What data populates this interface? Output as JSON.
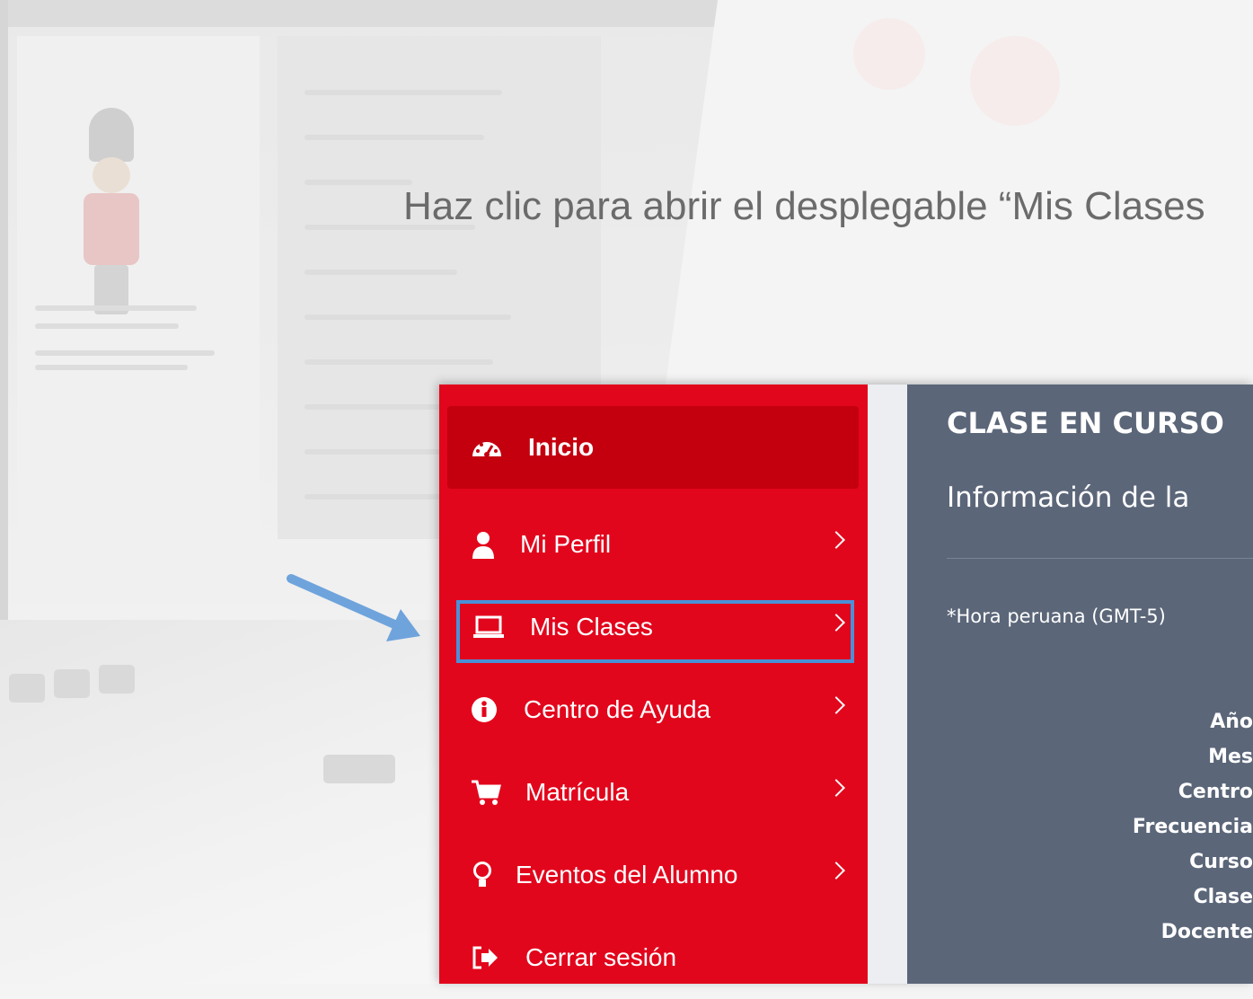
{
  "instruction": "Haz clic para abrir el desplegable “Mis Clases",
  "sidebar": {
    "items": [
      {
        "label": "Inicio",
        "icon": "dashboard-icon",
        "active": true
      },
      {
        "label": "Mi Perfil",
        "icon": "user-icon"
      },
      {
        "label": "Mis Clases",
        "icon": "laptop-icon",
        "highlighted": true
      },
      {
        "label": "Centro de Ayuda",
        "icon": "info-icon"
      },
      {
        "label": "Matrícula",
        "icon": "cart-icon"
      },
      {
        "label": "Eventos del Alumno",
        "icon": "lightbulb-icon"
      },
      {
        "label": "Cerrar sesión",
        "icon": "signout-icon"
      }
    ]
  },
  "content": {
    "title": "CLASE EN CURSO",
    "subtitle": "Información de la",
    "timezone_note": "*Hora peruana (GMT-5)",
    "fields": [
      "Año",
      "Mes",
      "Centro",
      "Frecuencia",
      "Curso",
      "Clase",
      "Docente"
    ]
  },
  "colors": {
    "sidebar_bg": "#e2061c",
    "sidebar_active": "#c4000f",
    "content_bg": "#5b6679",
    "highlight": "#4a90d9"
  }
}
